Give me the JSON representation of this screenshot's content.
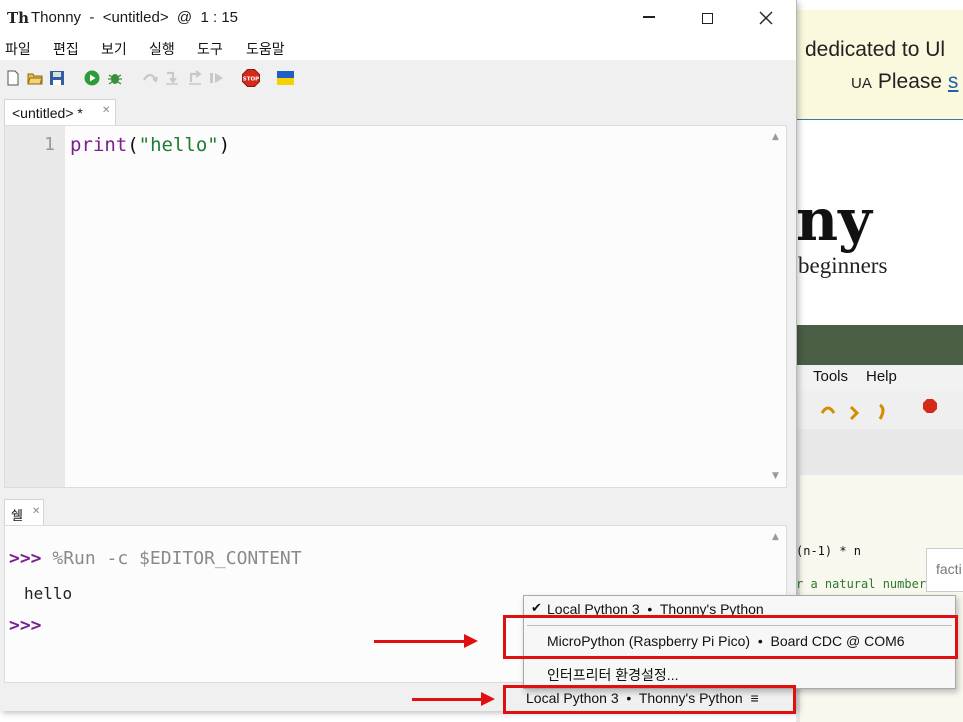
{
  "window": {
    "title": "Thonny  -  <untitled>  @  1 : 15",
    "app_icon": "Th"
  },
  "menu": [
    "파일",
    "편집",
    "보기",
    "실행",
    "도구",
    "도움말"
  ],
  "toolbar": {
    "icons": [
      "new-file-icon",
      "open-file-icon",
      "save-icon",
      "run-icon",
      "debug-icon",
      "step-over-icon",
      "step-into-icon",
      "step-out-icon",
      "resume-icon",
      "stop-icon",
      "ukraine-flag-icon"
    ],
    "stop_label": "STOP"
  },
  "editor": {
    "tab_label": "<untitled> *",
    "line_number": "1",
    "code": {
      "func": "print",
      "open": "(",
      "string": "\"hello\"",
      "close": ")"
    }
  },
  "shell": {
    "tab_label": "쉘",
    "prompt": ">>>",
    "command": "%Run -c $EDITOR_CONTENT",
    "output": "hello"
  },
  "interpreter_menu": {
    "items": [
      {
        "label": "Local Python 3  •  Thonny's Python",
        "checked": "✔"
      },
      {
        "label": "MicroPython (Raspberry Pi Pico)  •  Board CDC @ COM6"
      },
      {
        "label": "인터프리터 환경설정..."
      }
    ],
    "status": "Local Python 3  •  Thonny's Python  ≡"
  },
  "background_page": {
    "banner_line1": "dedicated to Ul",
    "banner_ua": "UA",
    "banner_line2_text": "Please",
    "banner_link": "s",
    "title_fragment": "ny",
    "subtitle_fragment": "beginners",
    "menu_tools": "Tools",
    "menu_help": "Help",
    "code_fragment_1": "(n-1) * n",
    "code_fragment_2": "r a natural number",
    "tooltip_fragment": "facti"
  },
  "colors": {
    "annotation_red": "#e01010",
    "keyword_purple": "#7a1f8f",
    "string_green": "#1e7d32",
    "banner_bg": "#fbf9dd"
  }
}
